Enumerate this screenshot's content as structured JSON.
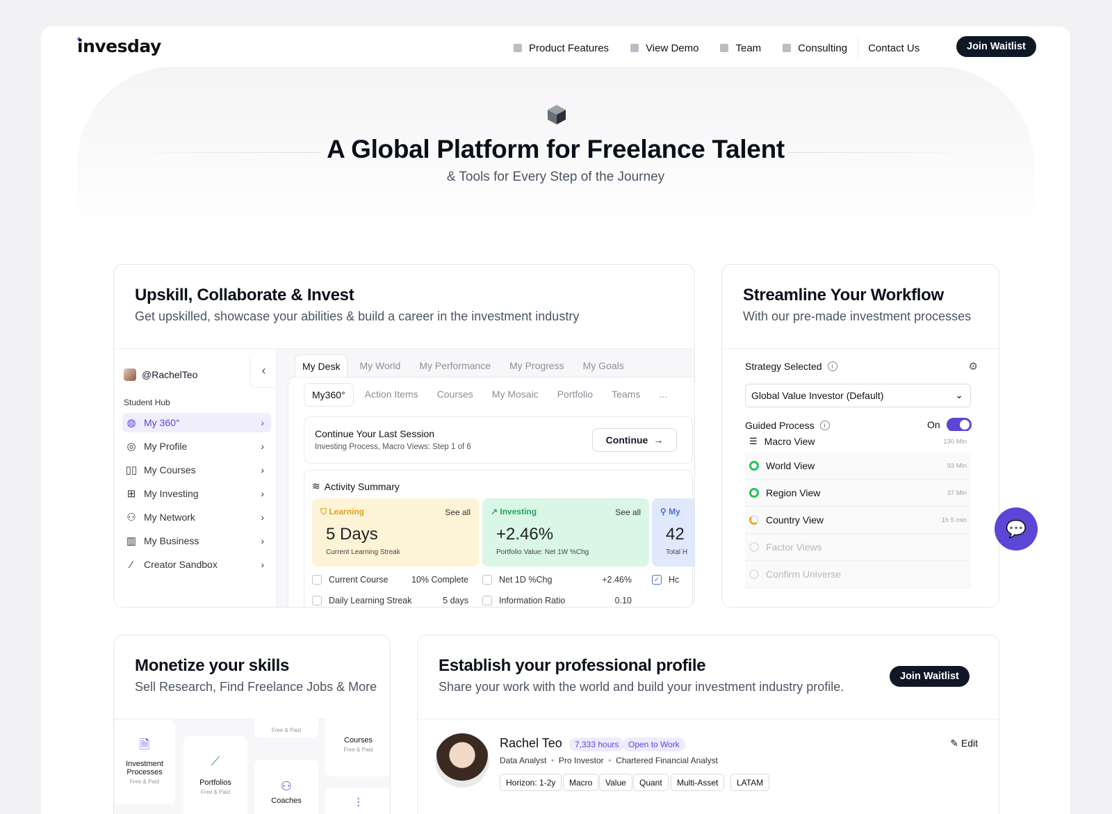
{
  "nav": {
    "logo": "invesday",
    "links": [
      "Product Features",
      "View Demo",
      "Team",
      "Consulting"
    ],
    "contact": "Contact Us",
    "cta": "Join Waitlist"
  },
  "hero": {
    "title": "A Global Platform for Freelance Talent",
    "subtitle": "& Tools for Every Step of the Journey"
  },
  "upskill": {
    "title": "Upskill, Collaborate & Invest",
    "subtitle": "Get upskilled, showcase your abilities & build a career in the investment industry",
    "username": "@RachelTeo",
    "hub_label": "Student Hub",
    "sidebar": [
      "My 360°",
      "My Profile",
      "My Courses",
      "My Investing",
      "My Network",
      "My Business",
      "Creator Sandbox"
    ],
    "main_tabs": [
      "My Desk",
      "My World",
      "My Performance",
      "My Progress",
      "My Goals"
    ],
    "sub_tabs": [
      "My360°",
      "Action Items",
      "Courses",
      "My Mosaic",
      "Portfolio",
      "Teams",
      "..."
    ],
    "session": {
      "title": "Continue Your Last Session",
      "subtitle": "Investing Process, Macro Views: Step 1 of 6",
      "button": "Continue"
    },
    "activity": {
      "title": "Activity Summary",
      "learning": {
        "label": "Learning",
        "see_all": "See all",
        "value": "5 Days",
        "caption": "Current Learning Streak"
      },
      "investing": {
        "label": "Investing",
        "see_all": "See all",
        "value": "+2.46%",
        "caption": "Portfolio Value: Net 1W %Chg"
      },
      "third": {
        "label": "My",
        "value": "42",
        "caption": "Total H"
      },
      "rows": [
        {
          "left": "Current Course",
          "right": "10% Complete"
        },
        {
          "left": "Net 1D %Chg",
          "right": "+2.46%"
        },
        {
          "left": "Hc"
        },
        {
          "left": "Daily Learning Streak",
          "right": "5 days"
        },
        {
          "left": "Information Ratio",
          "right": "0.10"
        }
      ]
    }
  },
  "workflow": {
    "title": "Streamline Your Workflow",
    "subtitle": "With our pre-made investment processes",
    "strategy_label": "Strategy Selected",
    "strategy_value": "Global Value Investor (Default)",
    "guided_label": "Guided Process",
    "guided_state": "On",
    "steps": [
      {
        "name": "Macro View",
        "mins": "130 Min"
      },
      {
        "name": "World View",
        "mins": "93 Min"
      },
      {
        "name": "Region View",
        "mins": "37 Min"
      },
      {
        "name": "Country View",
        "mins": "1h 5 min"
      },
      {
        "name": "Factor Views",
        "mins": ""
      },
      {
        "name": "Confirm Universe",
        "mins": ""
      }
    ]
  },
  "monetize": {
    "title": "Monetize your skills",
    "subtitle": "Sell Research, Find Freelance Jobs & More",
    "tiles": [
      {
        "label": "Investment Processes",
        "sub": "Free & Paid"
      },
      {
        "label": "Portfolios",
        "sub": "Free & Paid"
      },
      {
        "label": "",
        "sub": "Free & Paid"
      },
      {
        "label": "Coaches",
        "sub": ""
      },
      {
        "label": "Courses",
        "sub": "Free & Paid"
      }
    ]
  },
  "profile": {
    "title": "Establish your professional profile",
    "subtitle": "Share your work with the world and build your investment industry profile.",
    "cta": "Join Waitlist",
    "name": "Rachel Teo",
    "hours": "7,333 hours",
    "status": "Open to Work",
    "roles": [
      "Data Analyst",
      "Pro Investor",
      "Chartered Financial Analyst"
    ],
    "tags": [
      "Horizon: 1-2y",
      "Macro",
      "Value",
      "Quant",
      "Multi-Asset",
      "LATAM"
    ],
    "edit": "Edit"
  },
  "colors": {
    "accent": "#5b46d6",
    "dark": "#101828",
    "learning_bg": "#fdf3d6",
    "investing_bg": "#d9f6e6"
  }
}
